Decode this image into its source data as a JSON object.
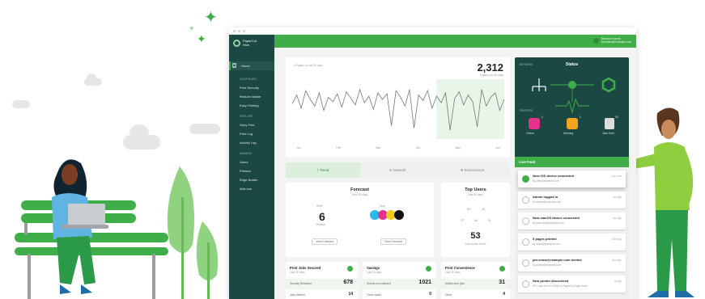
{
  "app": {
    "logo_line1": "PaperCut",
    "logo_line2": "Hive",
    "user_name": "Brendan Harris",
    "user_email": "brendan@example.com"
  },
  "sidebar": {
    "home": "Home",
    "configure_heading": "CONFIGURE",
    "configure_items": [
      "Print Security",
      "Reduce Waste",
      "Easy Printing"
    ],
    "explore_heading": "EXPLORE",
    "explore_items": [
      "Story Tree",
      "Print Log",
      "Activity Log"
    ],
    "manage_heading": "MANAGE",
    "manage_items": [
      "Users",
      "Printers",
      "Edge Nodes",
      "Add-ons"
    ]
  },
  "chart": {
    "legend_pages": "Pages",
    "legend_last": "Last 90 days",
    "total": "2,312",
    "total_sub": "Pages Last 30 days",
    "values": [
      32,
      40,
      28,
      44,
      36,
      30,
      42,
      26,
      38,
      34,
      41,
      29,
      43,
      37,
      31,
      45,
      33,
      39,
      27,
      42,
      36,
      41,
      12,
      44,
      38,
      30,
      45,
      10,
      40,
      35,
      44,
      28,
      39,
      33,
      42,
      8,
      37,
      43,
      31,
      40,
      34,
      11,
      45,
      30,
      38,
      42,
      26,
      36
    ],
    "axis_labels": [
      "Jan",
      "Feb",
      "Mar",
      "Apr",
      "May",
      "Jun"
    ]
  },
  "tabs": [
    "Trend",
    "Network",
    "Environment"
  ],
  "forecast": {
    "title": "Forecast",
    "sub": "Next 30 days",
    "refill_label": "Refill",
    "refill_value": "6",
    "refill_unit": "Reams",
    "toner_label": "Toner",
    "toner_colors": [
      "#2bb9e8",
      "#e5318e",
      "#f2cb1c",
      "#111111"
    ],
    "btn_left": "View Forecast",
    "btn_right": "View Forecast"
  },
  "top_users": {
    "title": "Top Users",
    "sub": "Last 30 days",
    "value": "53",
    "value_sub": "Total active Users",
    "initials": [
      "BH",
      "JM",
      "RT",
      "AK",
      "SL"
    ]
  },
  "status": {
    "network_label": "NETWORK",
    "title": "Status",
    "printers_label": "PRINTERS",
    "printer_items": [
      {
        "label": "Online",
        "count": "1",
        "color": "#e5318e"
      },
      {
        "label": "Warning",
        "count": "1",
        "color": "#f2a51c"
      },
      {
        "label": "Jobs Held",
        "count": "10",
        "color": "#dcdcdc"
      }
    ]
  },
  "live_feed": {
    "title": "Live Feed",
    "items": [
      {
        "title": "New iOS device connected",
        "sub": "by user@example.com",
        "age": "Just now"
      },
      {
        "title": "Admin logged in",
        "sub": "by admin@example.com",
        "age": "5m ago"
      },
      {
        "title": "New macOS device connected",
        "sub": "by jane.doe@example.com",
        "age": "8m ago"
      },
      {
        "title": "5 pages printed",
        "sub": "by mark@example.com",
        "age": "12m ago"
      },
      {
        "title": "jon.snow@example.com invited",
        "sub": "by admin@example.com",
        "age": "20m ago"
      },
      {
        "title": "New printer discovered",
        "sub": "HP LaserJet Pro M404 on PaperCut Edge Node",
        "age": "1h ago"
      }
    ]
  },
  "bottom_cards": [
    {
      "title": "Print Jobs Secured",
      "sub": "Last 30 days",
      "row1": "Security Released",
      "v1": "678",
      "row2": "Jobs deleted",
      "v2": "14"
    },
    {
      "title": "Savings",
      "sub": "Last 30 days",
      "row1": "Sheets not collected",
      "v1": "1021",
      "row2": "Trees saved",
      "v2": "0"
    },
    {
      "title": "Print Convenience",
      "sub": "Last 30 days",
      "row1": "Mobile print jobs",
      "v1": "31",
      "row2": "Other",
      "v2": "4"
    }
  ],
  "colors": {
    "brand_green": "#3fae49",
    "sidebar": "#1b4843",
    "accent_dark": "#1b4843"
  }
}
